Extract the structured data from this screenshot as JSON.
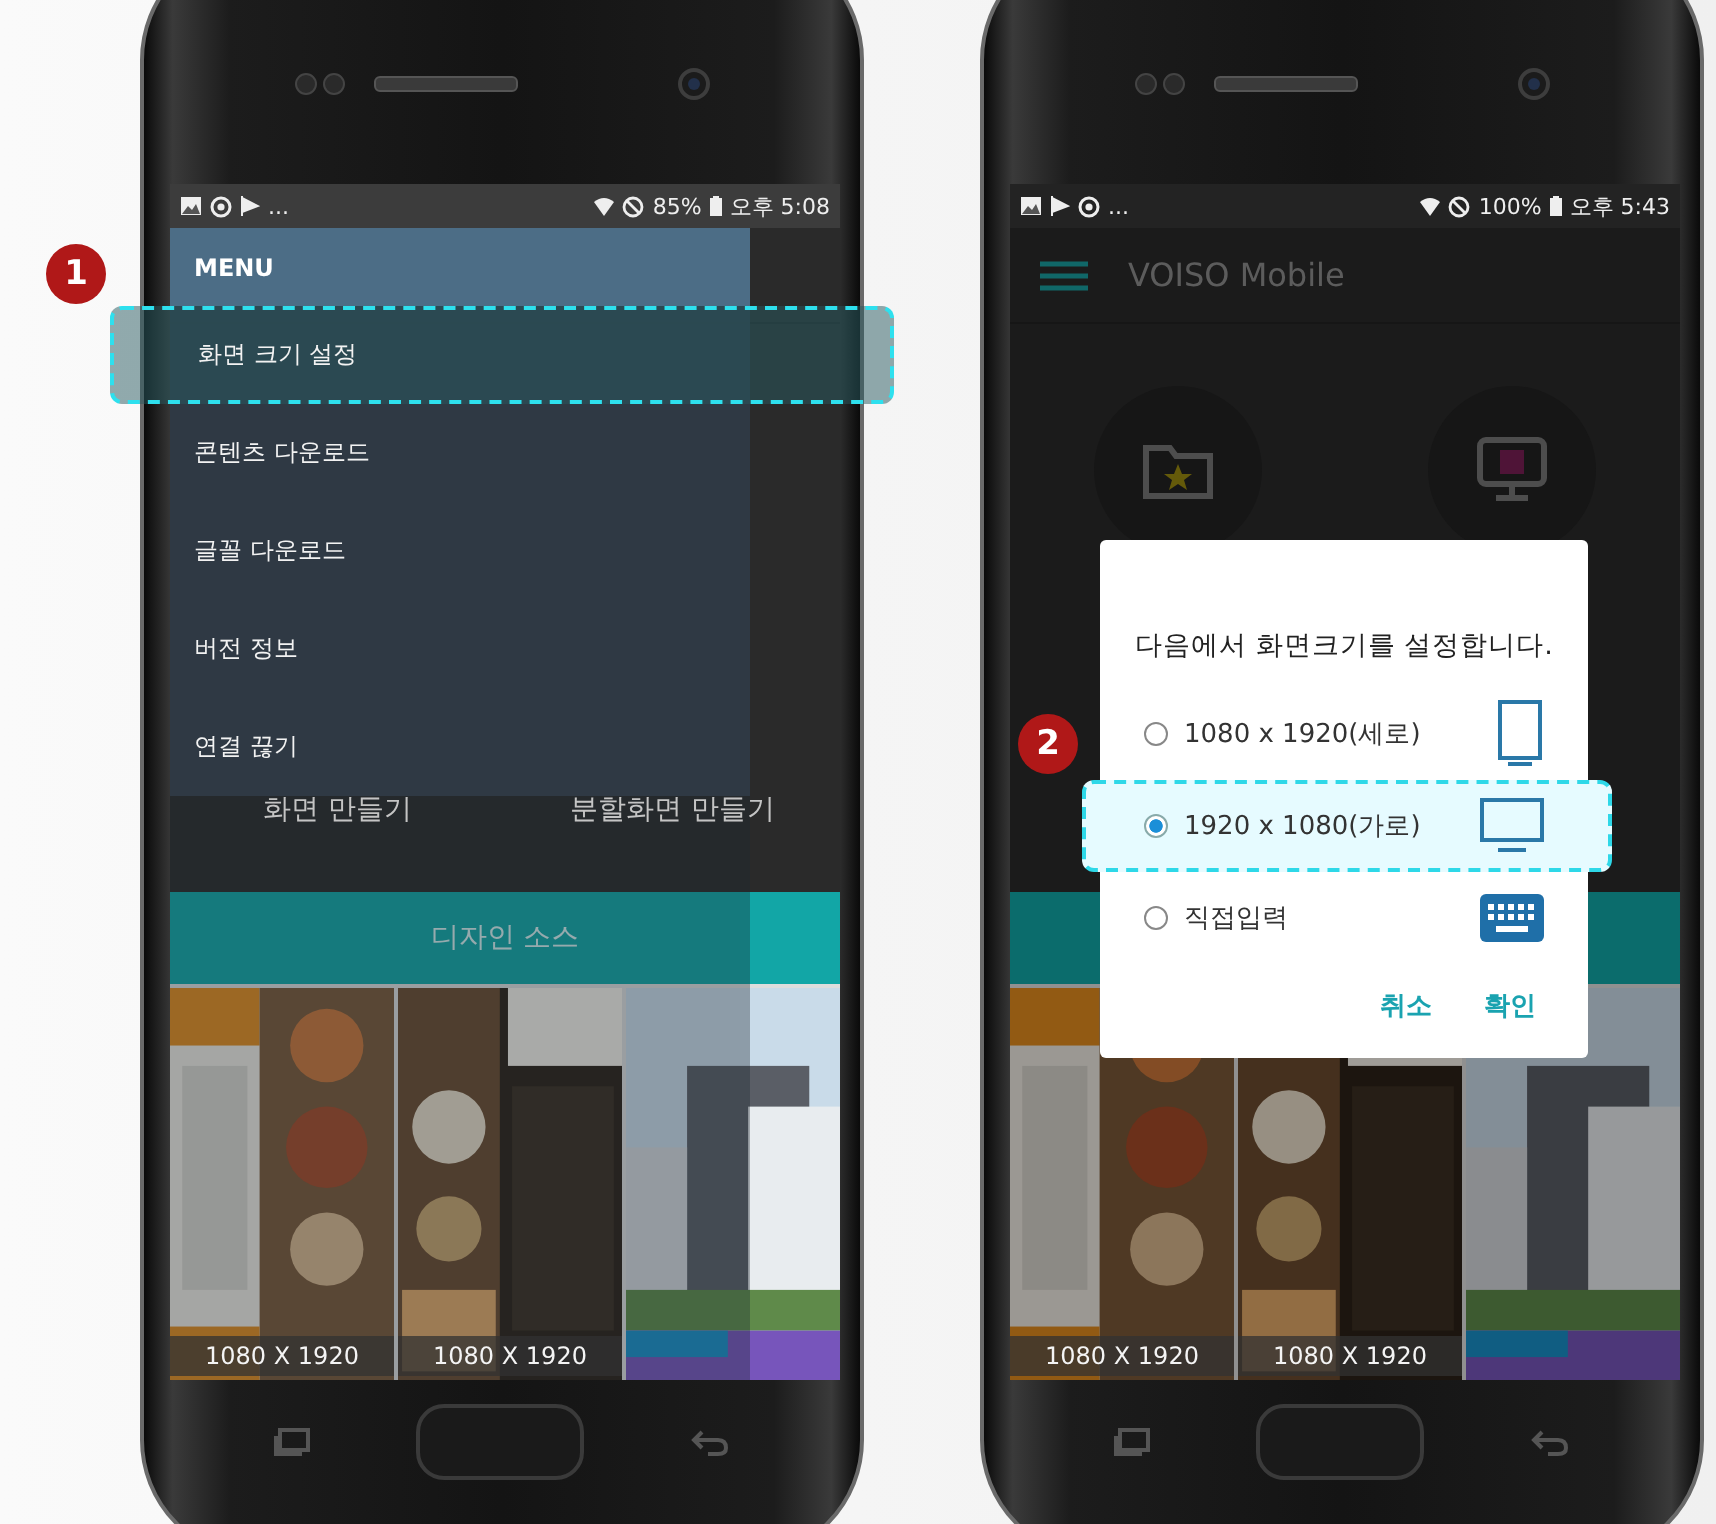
{
  "left_phone": {
    "status_bar": {
      "more": "...",
      "battery": "85%",
      "time": "오후 5:08"
    },
    "background_labels": [
      "화면 만들기",
      "분할화면 만들기"
    ],
    "menu": {
      "title": "MENU",
      "items": [
        {
          "label": "화면 크기 설정",
          "highlighted": true
        },
        {
          "label": "콘텐츠 다운로드",
          "highlighted": false
        },
        {
          "label": "글꼴 다운로드",
          "highlighted": false
        },
        {
          "label": "버전 정보",
          "highlighted": false
        },
        {
          "label": "연결 끊기",
          "highlighted": false
        }
      ]
    },
    "design_source": "디자인 소스",
    "thumbnails": [
      {
        "kind": "picture",
        "caption": "1080 X 1920"
      },
      {
        "kind": "picture",
        "caption": "1080 X 1920"
      },
      {
        "kind": "picture"
      }
    ]
  },
  "right_phone": {
    "status_bar": {
      "more": "...",
      "battery": "100%",
      "time": "오후 5:43"
    },
    "app_bar": {
      "title": "VOISO Mobile"
    },
    "dialog": {
      "message": "다음에서 화면크기를 설정합니다.",
      "options": [
        {
          "label": "1080 x 1920(세로)",
          "kind": "portrait",
          "selected": false,
          "highlighted": false
        },
        {
          "label": "1920 x 1080(가로)",
          "kind": "landscape",
          "selected": true,
          "highlighted": true
        },
        {
          "label": "직접입력",
          "kind": "keyboard",
          "selected": false,
          "highlighted": false
        }
      ],
      "buttons": [
        "취소",
        "확인"
      ]
    },
    "thumbnails": [
      {
        "kind": "picture",
        "caption": "1080 X 1920"
      },
      {
        "kind": "picture",
        "caption": "1080 X 1920"
      },
      {
        "kind": "picture"
      }
    ]
  },
  "callouts": [
    "1",
    "2"
  ]
}
